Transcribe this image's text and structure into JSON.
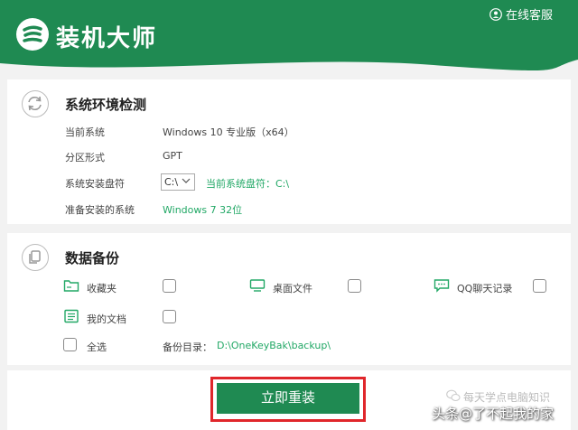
{
  "header": {
    "app_title": "装机大师",
    "service_label": "在线客服"
  },
  "env_check": {
    "title": "系统环境检测",
    "rows": [
      {
        "label": "当前系统",
        "value": "Windows 10 专业版（x64）"
      },
      {
        "label": "分区形式",
        "value": "GPT"
      },
      {
        "label": "系统安装盘符",
        "select_value": "C:\\",
        "hint": "当前系统盘符：C:\\"
      },
      {
        "label": "准备安装的系统",
        "value": "Windows 7 32位"
      }
    ]
  },
  "backup": {
    "title": "数据备份",
    "items": [
      {
        "label": "收藏夹",
        "icon": "folder-icon"
      },
      {
        "label": "桌面文件",
        "icon": "monitor-icon"
      },
      {
        "label": "QQ聊天记录",
        "icon": "chat-icon"
      },
      {
        "label": "我的文档",
        "icon": "document-icon"
      }
    ],
    "select_all_label": "全选",
    "dir_label": "备份目录：",
    "dir_path": "D:\\OneKeyBak\\backup\\"
  },
  "action": {
    "reinstall_label": "立即重装"
  },
  "watermark": {
    "line1": "每天学点电脑知识",
    "line2": "头条@了不起我的家"
  },
  "colors": {
    "brand_green": "#1f8a52",
    "hint_green": "#22a866",
    "highlight_red": "#e0262b"
  }
}
